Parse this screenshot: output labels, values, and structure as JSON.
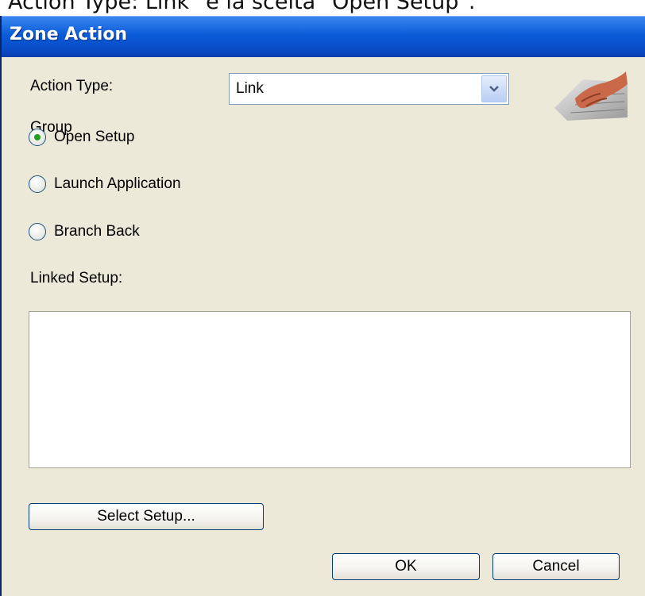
{
  "caption": "Action Type: Link\" e la scelta \"Open Setup\".",
  "dialog": {
    "title": "Zone Action",
    "action_type_label": "Action Type:",
    "action_type_value": "Link",
    "overlap_text": "Group",
    "radios": [
      {
        "label": "Open Setup",
        "checked": true
      },
      {
        "label": "Launch Application",
        "checked": false
      },
      {
        "label": "Branch Back",
        "checked": false
      }
    ],
    "linked_setup_label": "Linked Setup:",
    "select_setup_button": "Select Setup...",
    "ok_button": "OK",
    "cancel_button": "Cancel"
  },
  "colors": {
    "title_bar": "#0A5BD8",
    "dialog_bg": "#ECE9D8",
    "radio_dot": "#21A121"
  }
}
